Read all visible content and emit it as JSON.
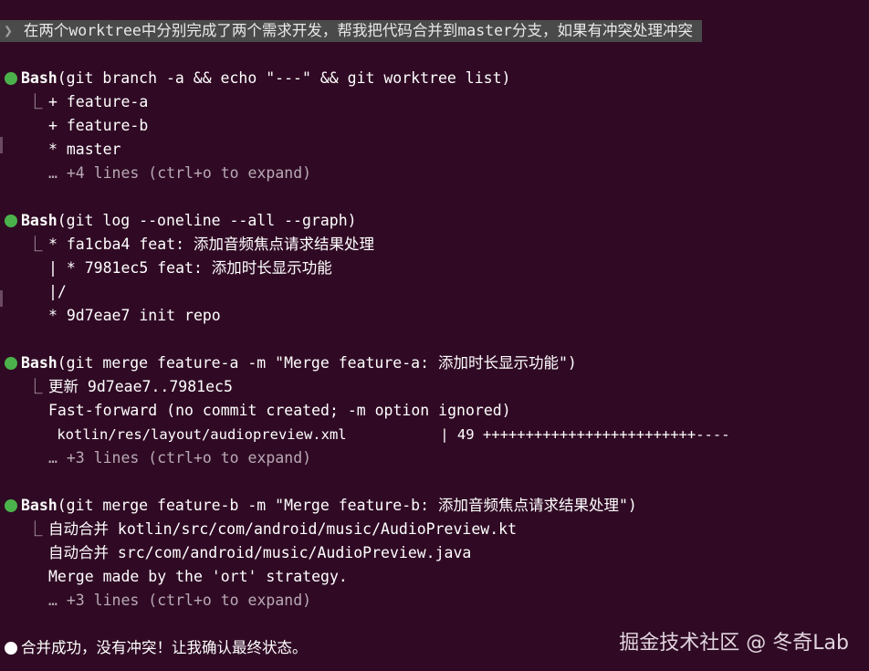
{
  "prompt": {
    "chevron": "❯",
    "text": " 在两个worktree中分别完成了两个需求开发，帮我把代码合并到master分支，如果有冲突处理冲突"
  },
  "blocks": [
    {
      "tool": "Bash",
      "command": "(git branch -a && echo \"---\" && git worktree list)",
      "output": [
        "+ feature-a",
        "+ feature-b",
        "* master"
      ],
      "collapsed": "… +4 lines (ctrl+o to expand)"
    },
    {
      "tool": "Bash",
      "command": "(git log --oneline --all --graph)",
      "output": [
        "* fa1cba4 feat: 添加音频焦点请求结果处理",
        "| * 7981ec5 feat: 添加时长显示功能",
        "|/",
        "* 9d7eae7 init repo"
      ],
      "collapsed": ""
    },
    {
      "tool": "Bash",
      "command": "(git merge feature-a -m \"Merge feature-a: 添加时长显示功能\")",
      "output": [
        "更新 9d7eae7..7981ec5",
        "Fast-forward (no commit created; -m option ignored)",
        " kotlin/res/layout/audiopreview.xml           | 49 +++++++++++++++++++++++++----"
      ],
      "collapsed": "… +3 lines (ctrl+o to expand)"
    },
    {
      "tool": "Bash",
      "command": "(git merge feature-b -m \"Merge feature-b: 添加音频焦点请求结果处理\")",
      "output": [
        "自动合并 kotlin/src/com/android/music/AudioPreview.kt",
        "自动合并 src/com/android/music/AudioPreview.java",
        "Merge made by the 'ort' strategy."
      ],
      "collapsed": "… +3 lines (ctrl+o to expand)"
    }
  ],
  "final_message": "合并成功，没有冲突！让我确认最终状态。",
  "corner_glyph": "⎿",
  "watermark": "掘金技术社区 @ 冬奇Lab",
  "colors": {
    "background": "#300a24",
    "success_dot": "#4bb24b",
    "message_dot": "#ffffff",
    "prompt_bg": "#4a4a4a"
  }
}
